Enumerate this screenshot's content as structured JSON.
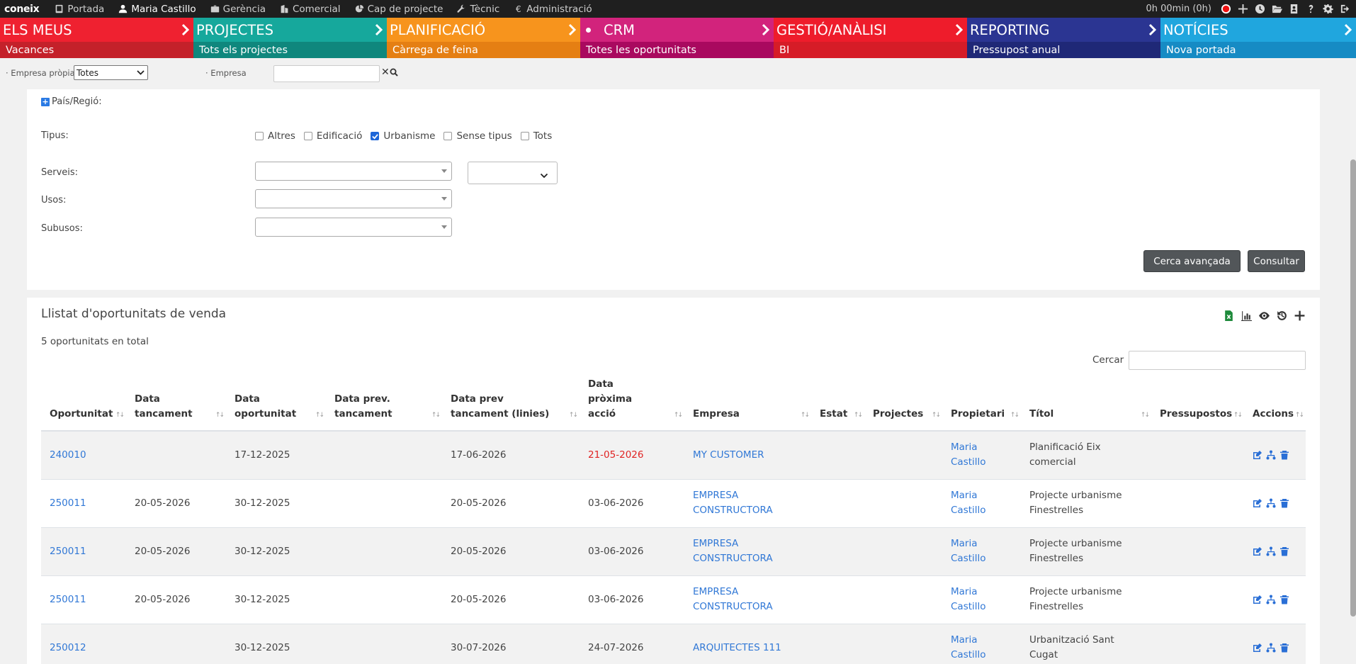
{
  "topbar": {
    "logo": "coneix",
    "nav": [
      {
        "label": "Portada",
        "icon": "tablet-icon"
      },
      {
        "label": "Maria Castillo",
        "icon": "user-icon"
      },
      {
        "label": "Gerència",
        "icon": "briefcase-icon"
      },
      {
        "label": "Comercial",
        "icon": "building-icon"
      },
      {
        "label": "Cap de projecte",
        "icon": "chart-pie-icon"
      },
      {
        "label": "Tècnic",
        "icon": "wrench-icon"
      },
      {
        "label": "Administració",
        "icon": "euro-icon"
      }
    ],
    "timer": "0h 00min (0h)"
  },
  "modules": [
    {
      "title": "ELS MEUS",
      "sub": "Vacances",
      "top_color": "#ef2130",
      "bot_color": "#c4212a"
    },
    {
      "title": "PROJECTES",
      "sub": "Tots els projectes",
      "top_color": "#16a89c",
      "bot_color": "#0f877d"
    },
    {
      "title": "PLANIFICACIÓ",
      "sub": "Càrrega de feina",
      "top_color": "#f7941d",
      "bot_color": "#e57f13"
    },
    {
      "title": "CRM",
      "sub": "Totes les oportunitats",
      "top_color": "#d2237c",
      "bot_color": "#a9095f"
    },
    {
      "title": "GESTIÓ/ANÀLISI",
      "sub": "BI",
      "top_color": "#ee1c2b",
      "bot_color": "#d61c27"
    },
    {
      "title": "REPORTING",
      "sub": "Pressupost anual",
      "top_color": "#2b3592",
      "bot_color": "#1f2877"
    },
    {
      "title": "NOTÍCIES",
      "sub": "Nova portada",
      "top_color": "#20a6de",
      "bot_color": "#168bc4"
    }
  ],
  "filters": {
    "empresa_propia_label": "· Empresa pròpia",
    "empresa_propia_value": "Totes",
    "empresa_label": "· Empresa",
    "empresa_value": ""
  },
  "panel": {
    "region_label": "País/Regió:",
    "tipus_label": "Tipus:",
    "tipus_options": [
      {
        "label": "Altres",
        "checked": false
      },
      {
        "label": "Edificació",
        "checked": false
      },
      {
        "label": "Urbanisme",
        "checked": true
      },
      {
        "label": "Sense tipus",
        "checked": false
      },
      {
        "label": "Tots",
        "checked": false
      }
    ],
    "serveis_label": "Serveis:",
    "usos_label": "Usos:",
    "subusos_label": "Subusos:",
    "btn_advanced": "Cerca avançada",
    "btn_query": "Consultar"
  },
  "list": {
    "title": "Llistat d'oportunitats de venda",
    "total": "5 oportunitats en total",
    "search_label": "Cercar",
    "search_value": "",
    "columns": [
      "Oportunitat",
      "Data tancament",
      "Data oportunitat",
      "Data prev. tancament",
      "Data prev tancament (linies)",
      "Data pròxima acció",
      "Empresa",
      "Estat",
      "Projectes",
      "Propietari",
      "Títol",
      "Pressupostos",
      "Accions"
    ],
    "rows": [
      {
        "id": "240010",
        "tancament": "",
        "oportunitat": "17-12-2025",
        "prev": "",
        "prev_linies": "17-06-2026",
        "proxima": "21-05-2026",
        "proxima_overdue": true,
        "empresa": "MY CUSTOMER",
        "estat": "",
        "projectes": "",
        "propietari": "Maria Castillo",
        "titol": "Planificació Eix comercial",
        "pressupostos": ""
      },
      {
        "id": "250011",
        "tancament": "20-05-2026",
        "oportunitat": "30-12-2025",
        "prev": "",
        "prev_linies": "20-05-2026",
        "proxima": "03-06-2026",
        "proxima_overdue": false,
        "empresa": "EMPRESA CONSTRUCTORA",
        "estat": "",
        "projectes": "",
        "propietari": "Maria Castillo",
        "titol": "Projecte urbanisme Finestrelles",
        "pressupostos": ""
      },
      {
        "id": "250011",
        "tancament": "20-05-2026",
        "oportunitat": "30-12-2025",
        "prev": "",
        "prev_linies": "20-05-2026",
        "proxima": "03-06-2026",
        "proxima_overdue": false,
        "empresa": "EMPRESA CONSTRUCTORA",
        "estat": "",
        "projectes": "",
        "propietari": "Maria Castillo",
        "titol": "Projecte urbanisme Finestrelles",
        "pressupostos": ""
      },
      {
        "id": "250011",
        "tancament": "20-05-2026",
        "oportunitat": "30-12-2025",
        "prev": "",
        "prev_linies": "20-05-2026",
        "proxima": "03-06-2026",
        "proxima_overdue": false,
        "empresa": "EMPRESA CONSTRUCTORA",
        "estat": "",
        "projectes": "",
        "propietari": "Maria Castillo",
        "titol": "Projecte urbanisme Finestrelles",
        "pressupostos": ""
      },
      {
        "id": "250012",
        "tancament": "",
        "oportunitat": "30-12-2025",
        "prev": "",
        "prev_linies": "30-07-2026",
        "proxima": "24-07-2026",
        "proxima_overdue": false,
        "empresa": "ARQUITECTES 111",
        "estat": "",
        "projectes": "",
        "propietari": "Maria Castillo",
        "titol": "Urbanització Sant Cugat",
        "pressupostos": ""
      }
    ]
  },
  "colors": {
    "link": "#3178d6",
    "overdue": "#e02424",
    "button": "#525659"
  }
}
